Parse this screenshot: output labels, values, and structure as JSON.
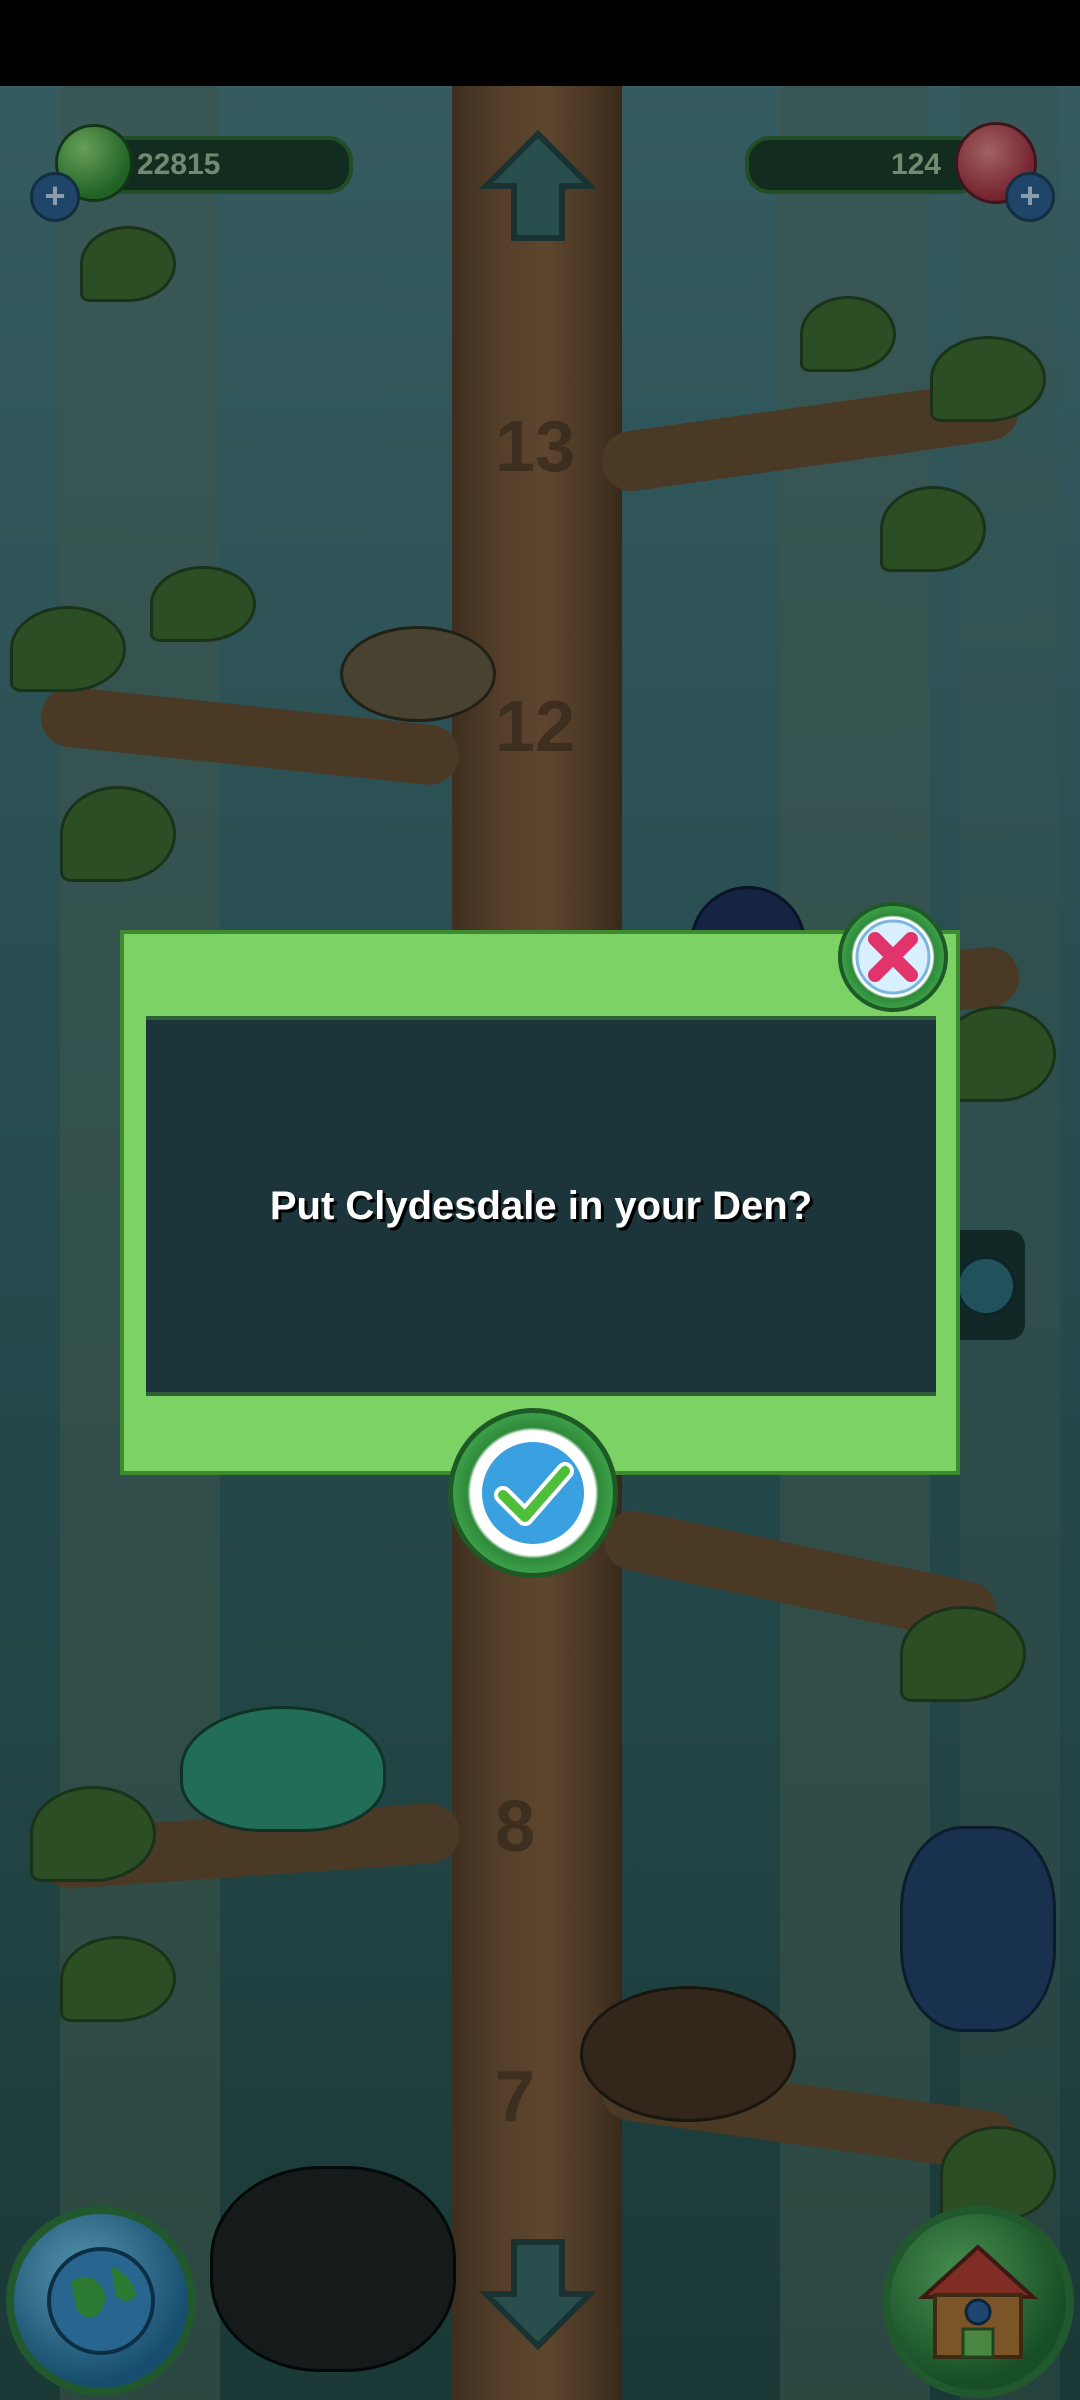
{
  "hud": {
    "coins": "22815",
    "gems": "124",
    "plus_symbol": "+"
  },
  "tree": {
    "levels": [
      "13",
      "12",
      "8",
      "7"
    ]
  },
  "dialog": {
    "message": "Put Clydesdale in your Den?"
  },
  "icons": {
    "close": "close-icon",
    "confirm": "check-icon",
    "up": "up-arrow-icon",
    "down": "down-arrow-icon",
    "globe": "globe-icon",
    "den": "den-house-icon",
    "coins": "green-coin-icon",
    "gems": "red-gem-icon"
  },
  "colors": {
    "dialog_frame": "#7cd264",
    "dialog_panel": "#1b353b",
    "close_accent": "#e0346a",
    "confirm_accent": "#3aa0e0"
  }
}
